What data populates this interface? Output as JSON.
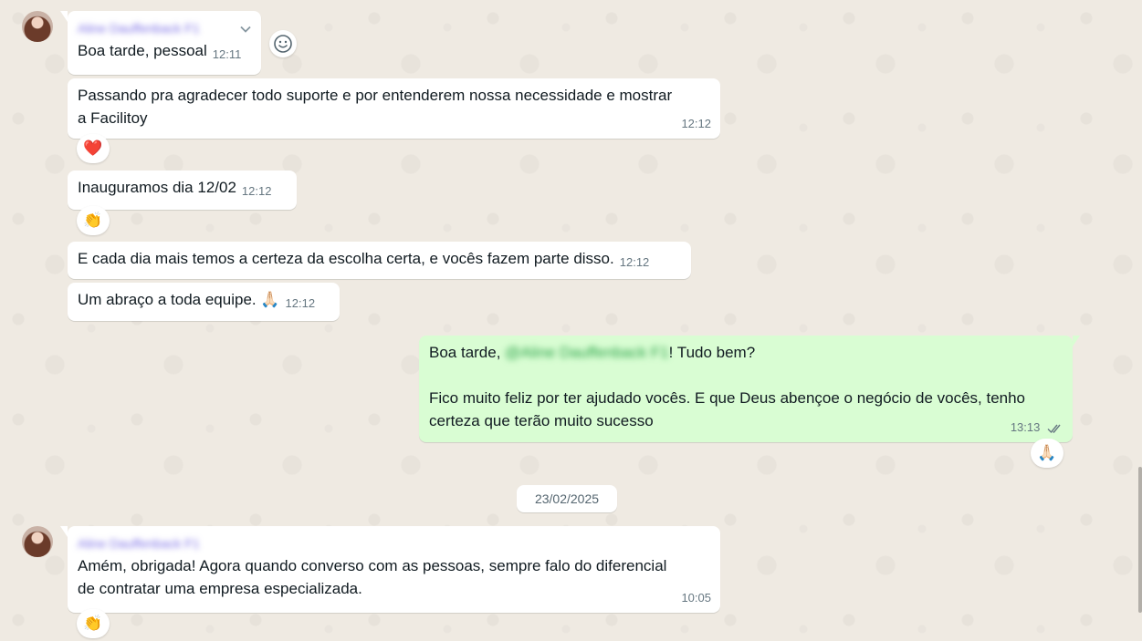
{
  "contact": {
    "name": "Aline Dauffenback F1"
  },
  "messages": [
    {
      "text": "Boa tarde, pessoal",
      "time": "12:11"
    },
    {
      "text_line1": "Passando pra agradecer todo suporte e por entenderem nossa necessidade e mostrar",
      "text_line2": "a Facilitoy",
      "time": "12:12",
      "reaction": "❤️"
    },
    {
      "text": "Inauguramos dia 12/02",
      "time": "12:12",
      "reaction": "👏"
    },
    {
      "text": "E cada dia mais temos a certeza da escolha certa, e vocês fazem parte disso.",
      "time": "12:12"
    },
    {
      "text": "Um abraço a toda equipe. 🙏🏻",
      "time": "12:12"
    }
  ],
  "outgoing": {
    "greeting_prefix": "Boa tarde, ",
    "greeting_name": "@Aline Dauffenback F1",
    "greeting_suffix": "! Tudo bem?",
    "line2": "Fico muito feliz por ter ajudado vocês. E que Deus abençoe o negócio de vocês, tenho",
    "line3": "certeza que terão muito sucesso",
    "time": "13:13",
    "status": "read",
    "reaction": "🙏🏻"
  },
  "date_separator": "23/02/2025",
  "last_message": {
    "sender": "Aline Dauffenback F1",
    "line1": "Amém, obrigada! Agora quando converso com as pessoas, sempre falo do diferencial",
    "line2": "de contratar uma empresa especializada.",
    "time": "10:05",
    "reaction": "👏"
  },
  "colors": {
    "incoming": "#ffffff",
    "outgoing": "#d9fdd3",
    "background": "#efeae2"
  }
}
